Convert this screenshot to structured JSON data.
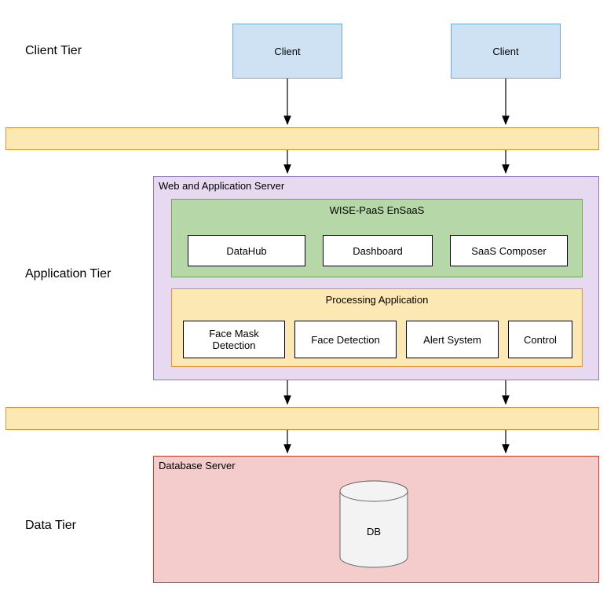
{
  "tiers": {
    "client": "Client Tier",
    "application": "Application Tier",
    "data": "Data Tier"
  },
  "clientBoxes": [
    "Client",
    "Client"
  ],
  "webAppServer": {
    "title": "Web and Application Server",
    "ensaas": {
      "title": "WISE-PaaS EnSaaS",
      "items": [
        "DataHub",
        "Dashboard",
        "SaaS Composer"
      ]
    },
    "processing": {
      "title": "Processing Application",
      "items": [
        "Face Mask Detection",
        "Face Detection",
        "Alert System",
        "Control"
      ]
    }
  },
  "databaseServer": {
    "title": "Database Server",
    "db": "DB"
  },
  "colors": {
    "clientFill": "#cfe2f3",
    "clientStroke": "#6fa8dc",
    "barFill": "#fce8b2",
    "barStroke": "#e69138",
    "webAppFill": "#e6d9f0",
    "webAppStroke": "#8e7cc3",
    "ensaasFill": "#b6d7a8",
    "ensaasStroke": "#6aa84f",
    "processingFill": "#fce8b2",
    "processingStroke": "#e69138",
    "dbServerFill": "#f4cccc",
    "dbServerStroke": "#cc4125",
    "dbCylFill": "#f3f3f3"
  }
}
